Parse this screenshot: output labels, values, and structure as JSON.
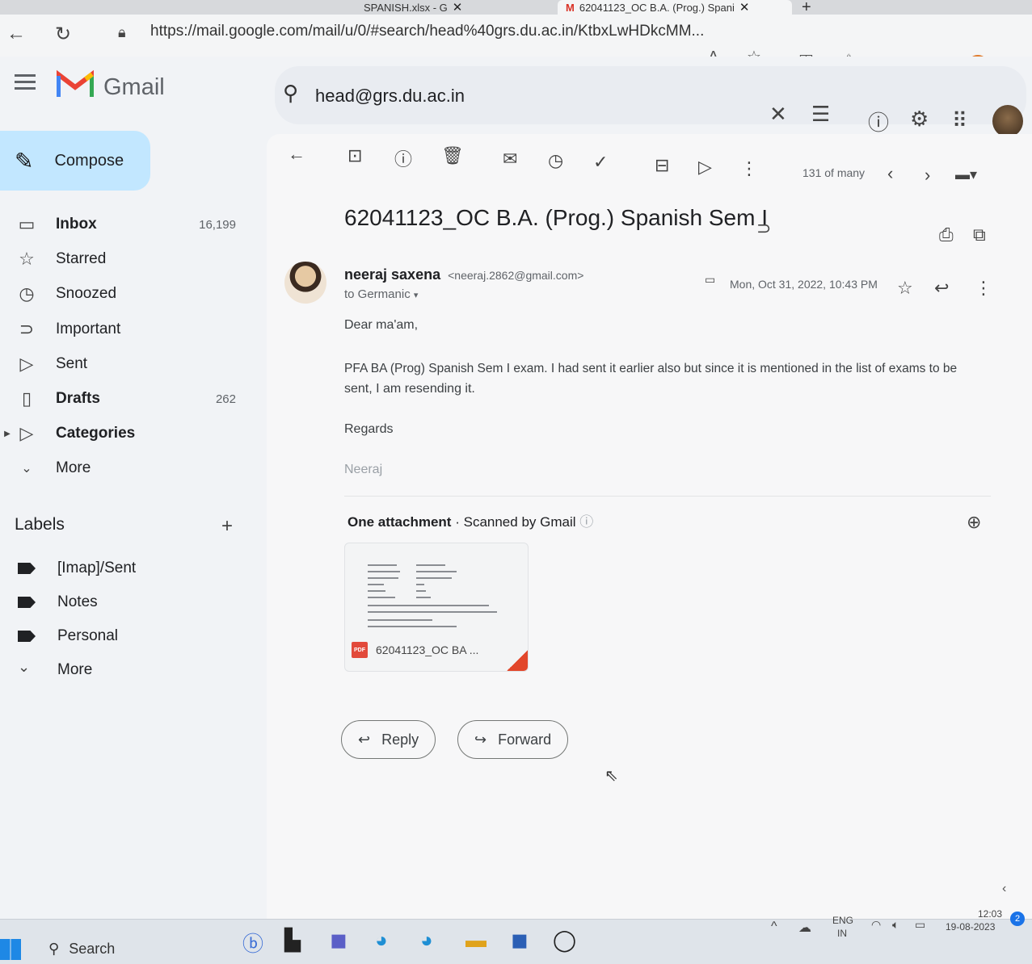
{
  "browser": {
    "tabs": [
      {
        "title": "SPANISH.xlsx - G",
        "active": false
      },
      {
        "title": "62041123_OC B.A. (Prog.) Spani",
        "active": true
      }
    ],
    "url": "https://mail.google.com/mail/u/0/#search/head%40grs.du.ac.in/KtbxLwHDkcMM...",
    "icons": [
      "back-arrow-icon",
      "reload-icon",
      "lock-icon",
      "read-aloud-icon",
      "star-icon",
      "split-screen-icon",
      "favorites-icon",
      "collections-icon",
      "extensions-icon",
      "profile-icon",
      "more-icon"
    ]
  },
  "gmail": {
    "app_name": "Gmail",
    "search_query": "head@grs.du.ac.in",
    "compose_label": "Compose",
    "nav": [
      {
        "label": "Inbox",
        "count": "16,199",
        "icon": "inbox-icon",
        "bold": true
      },
      {
        "label": "Starred",
        "count": "",
        "icon": "star-icon",
        "bold": false
      },
      {
        "label": "Snoozed",
        "count": "",
        "icon": "clock-icon",
        "bold": false
      },
      {
        "label": "Important",
        "count": "",
        "icon": "important-icon",
        "bold": false
      },
      {
        "label": "Sent",
        "count": "",
        "icon": "send-icon",
        "bold": false
      },
      {
        "label": "Drafts",
        "count": "262",
        "icon": "draft-icon",
        "bold": true
      },
      {
        "label": "Categories",
        "count": "",
        "icon": "label-icon",
        "bold": true
      },
      {
        "label": "More",
        "count": "",
        "icon": "chevron-down-icon",
        "bold": false
      }
    ],
    "labels_header": "Labels",
    "labels": [
      {
        "label": "[Imap]/Sent"
      },
      {
        "label": "Notes"
      },
      {
        "label": "Personal"
      },
      {
        "label": "More"
      }
    ],
    "toolbar": {
      "counter": "131 of many"
    },
    "email": {
      "subject": "62041123_OC B.A. (Prog.) Spanish Sem I",
      "sender_name": "neeraj saxena",
      "sender_email": "<neeraj.2862@gmail.com>",
      "to": "to Germanic",
      "date": "Mon, Oct 31, 2022, 10:43 PM",
      "greeting": "Dear ma'am,",
      "body_line1": "PFA BA (Prog) Spanish Sem I exam. I had sent it earlier also but since it is mentioned in the list of exams to be",
      "body_line2": "sent, I am resending it.",
      "regards": "Regards",
      "signature": "Neeraj",
      "attachment_count": "One attachment",
      "scanned": "Scanned by Gmail",
      "attachment_name": "62041123_OC BA ...",
      "attachment_badge": "PDF"
    },
    "reply_label": "Reply",
    "forward_label": "Forward"
  },
  "taskbar": {
    "search_label": "Search",
    "lang_top": "ENG",
    "lang_bottom": "IN",
    "time": "12:03",
    "date": "19-08-2023",
    "notification_count": "2"
  }
}
